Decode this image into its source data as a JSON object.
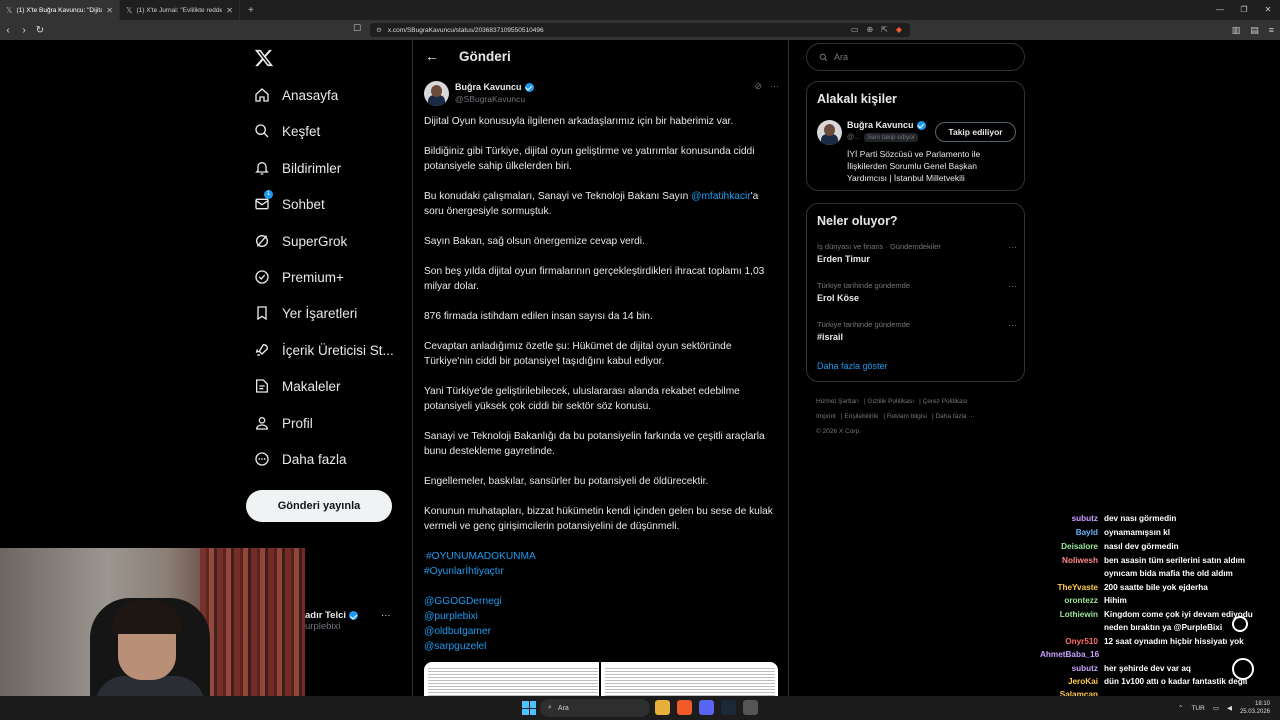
{
  "browser": {
    "tabs": [
      {
        "label": "(1) X'te Buğra Kavuncu: \"Dijital O",
        "active": true
      },
      {
        "label": "(1) X'te Jurnal: \"Evlilikte reddettiği ad",
        "active": false
      }
    ],
    "url": "x.com/SBugraKavuncu/status/2036837109550510496"
  },
  "sidebar": {
    "items": [
      {
        "label": "Anasayfa",
        "icon": "home-icon"
      },
      {
        "label": "Keşfet",
        "icon": "search-icon"
      },
      {
        "label": "Bildirimler",
        "icon": "bell-icon"
      },
      {
        "label": "Sohbet",
        "icon": "mail-icon",
        "badge": "1"
      },
      {
        "label": "SuperGrok",
        "icon": "grok-icon"
      },
      {
        "label": "Premium+",
        "icon": "premium-icon"
      },
      {
        "label": "Yer İşaretleri",
        "icon": "bookmark-icon"
      },
      {
        "label": "İçerik Üreticisi St...",
        "icon": "rocket-icon"
      },
      {
        "label": "Makaleler",
        "icon": "article-icon"
      },
      {
        "label": "Profil",
        "icon": "person-icon"
      },
      {
        "label": "Daha fazla",
        "icon": "more-circle-icon"
      }
    ],
    "post_button": "Gönderi yayınla",
    "account": {
      "name": "adır Telci",
      "handle": "urplebixi"
    }
  },
  "main": {
    "title": "Gönderi",
    "author": {
      "name": "Buğra Kavuncu",
      "handle": "@SBugraKavuncu"
    },
    "paragraphs": [
      "Dijital Oyun konusuyla ilgilenen arkadaşlarımız için bir haberimiz var.",
      "Bildiğiniz gibi Türkiye, dijital oyun geliştirme ve yatırımlar konusunda ciddi potansiyele sahip ülkelerden biri.",
      "Sayın Bakan, sağ olsun önergemize cevap verdi.",
      "Son beş yılda dijital oyun firmalarının gerçekleştirdikleri ihracat toplamı 1,03 milyar dolar.",
      "876 firmada istihdam edilen insan sayısı da 14 bin.",
      "Cevaptan anladığımız özetle şu: Hükümet de dijital oyun sektöründe Türkiye'nin ciddi bir potansiyel taşıdığını kabul ediyor.",
      "Yani Türkiye'de geliştirilebilecek, uluslararası alanda rekabet edebilme potansiyeli yüksek çok ciddi bir sektör söz konusu.",
      "Sanayi ve Teknoloji Bakanlığı da bu potansiyelin farkında ve çeşitli araçlarla bunu destekleme gayretinde.",
      "Engellemeler, baskılar, sansürler bu potansiyeli de öldürecektir.",
      "Konunun muhatapları, bizzat hükümetin kendi içinden gelen bu sese de kulak vermeli ve genç girişimcilerin potansiyelini de düşünmeli."
    ],
    "mention_para": {
      "before": "Bu konudaki çalışmaları, Sanayi ve Teknoloji Bakanı Sayın ",
      "mention": "@mfatihkacir",
      "after": "'a soru önergesiyle sormuştuk."
    },
    "hashtags": [
      "#OYUNUMADOKUNMA",
      "#Oyunlarİhtiyaçtır"
    ],
    "mentions": [
      "@GGOGDernegi",
      "@purplebixi",
      "@oldbutgamer",
      "@sarpguzelel"
    ]
  },
  "right": {
    "search_placeholder": "Ara",
    "related": {
      "title": "Alakalı kişiler",
      "name": "Buğra Kavuncu",
      "handle": "@...",
      "follows_you": "Seni takip ediyor",
      "follow_button": "Takip ediliyor",
      "bio": "İYİ Parti Sözcüsü ve Parlamento ile İlişkilerden Sorumlu Genel Başkan Yardımcısı | İstanbul Milletvekili"
    },
    "trends": {
      "title": "Neler oluyor?",
      "items": [
        {
          "category": "İş dünyası ve finans · Gündemdekiler",
          "name": "Erden Timur"
        },
        {
          "category": "Türkiye tarihinde gündemde",
          "name": "Erol Köse"
        },
        {
          "category": "Türkiye tarihinde gündemde",
          "name": "#israil"
        }
      ],
      "show_more": "Daha fazla göster"
    },
    "footer": [
      "Hizmet Şartları",
      "Gizlilik Politikası",
      "Çerez Politikası",
      "Imprint",
      "Erişilebilirlik",
      "Reklam bilgisi",
      "Daha fazla ···",
      "© 2026 X Corp."
    ]
  },
  "chat": [
    {
      "user": "subutz",
      "color": "#c9a0ff",
      "msg": "dev nası görmedin"
    },
    {
      "user": "Bayld",
      "color": "#6ab0ff",
      "msg": "oynamamışsın kl"
    },
    {
      "user": "Deisalore",
      "color": "#9be89b",
      "msg": "nasıl dev görmedin"
    },
    {
      "user": "Noliwesh",
      "color": "#ff8a8a",
      "msg": "ben asasin tüm serilerini satın aldım"
    },
    {
      "user": "",
      "color": "#ffffff",
      "msg": "oynıcam bida mafia the old aldım"
    },
    {
      "user": "TheYvaste",
      "color": "#ffcc4d",
      "msg": "200 saatte bile yok ejderha"
    },
    {
      "user": "orontezz",
      "color": "#9be89b",
      "msg": "Hihim"
    },
    {
      "user": "Lothiewin",
      "color": "#9be89b",
      "msg": "Kingdom come çok iyi devam ediyodu"
    },
    {
      "user": "",
      "color": "#ffffff",
      "msg": "neden bıraktın ya @PurpleBixi"
    },
    {
      "user": "Onyr510",
      "color": "#ff6b6b",
      "msg": "12 saat oynadım hiçbir hissiyatı yok"
    },
    {
      "user": "AhmetBaba_16",
      "color": "#c9a0ff",
      "msg": ""
    },
    {
      "user": "subutz",
      "color": "#c9a0ff",
      "msg": "her şehirde dev var aq"
    },
    {
      "user": "JeroKai",
      "color": "#ffcc4d",
      "msg": "dün 1v100 attı o kadar fantastik değil"
    },
    {
      "user": "Salamcan",
      "color": "#ffcc4d",
      "msg": ""
    }
  ],
  "taskbar": {
    "search": "Ara",
    "lang": "TUR",
    "time": "18:10",
    "date": "25.03.2026"
  }
}
